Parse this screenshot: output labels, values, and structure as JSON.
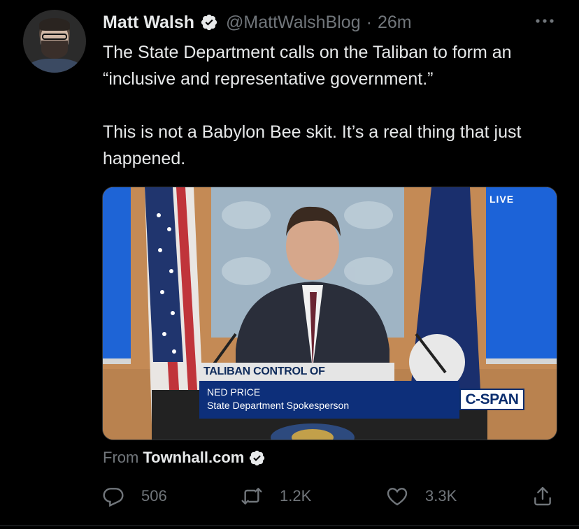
{
  "tweet": {
    "author_name": "Matt Walsh",
    "handle": "@MattWalshBlog",
    "separator": "·",
    "time": "26m",
    "text": "The State Department calls on the Taliban to form an “inclusive and representative government.”\n\nThis is not a Babylon Bee skit. It’s a real thing that just happened.",
    "media": {
      "live_label": "LIVE",
      "lower_third_title": "TALIBAN CONTROL OF AFGHANISTAN",
      "lower_third_name": "NED PRICE",
      "lower_third_role": "State Department Spokesperson",
      "network_logo": "C-SPAN"
    },
    "source": {
      "from_label": "From",
      "site": "Townhall.com"
    },
    "actions": {
      "replies": "506",
      "retweets": "1.2K",
      "likes": "3.3K"
    }
  },
  "icons": {
    "verified": "verified-badge-icon",
    "more": "more-options-icon",
    "reply": "reply-icon",
    "retweet": "retweet-icon",
    "like": "heart-icon",
    "share": "share-icon"
  },
  "colors": {
    "background": "#000000",
    "text_primary": "#e7e9ea",
    "text_secondary": "#71767b",
    "divider": "#2f3336"
  }
}
